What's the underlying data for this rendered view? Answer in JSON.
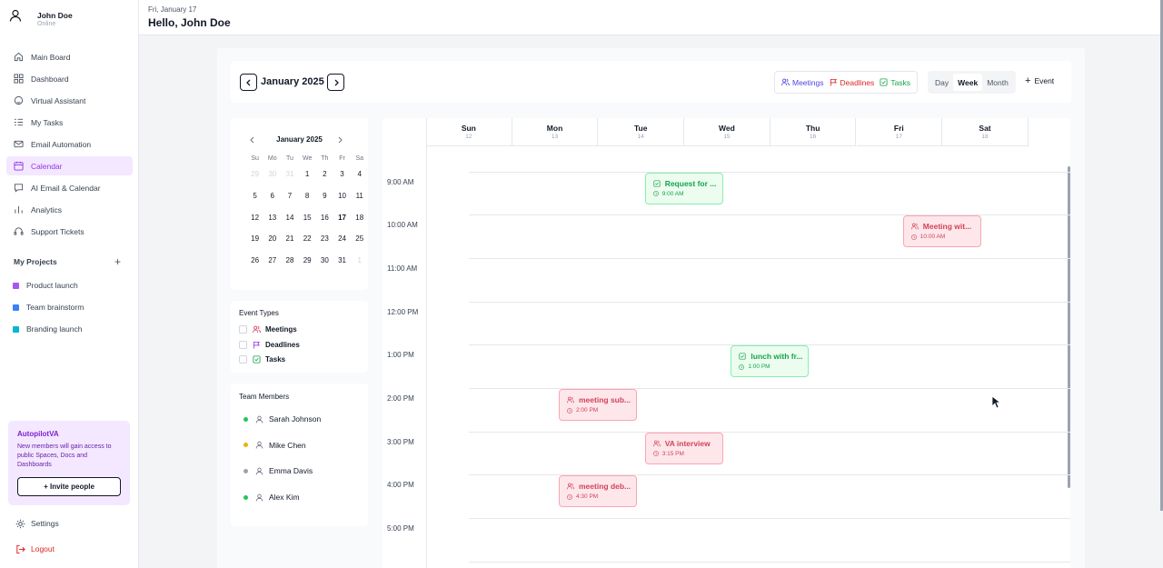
{
  "user": {
    "name": "John Doe",
    "status": "Online"
  },
  "sidebar": {
    "items": [
      {
        "label": "Main Board",
        "icon": "home-icon"
      },
      {
        "label": "Dashboard",
        "icon": "grid-icon"
      },
      {
        "label": "Virtual Assistant",
        "icon": "assistant-icon"
      },
      {
        "label": "My Tasks",
        "icon": "list-icon"
      },
      {
        "label": "Email Automation",
        "icon": "mail-icon"
      },
      {
        "label": "Calendar",
        "icon": "calendar-icon",
        "active": true
      },
      {
        "label": "AI Email & Calendar",
        "icon": "chat-icon"
      },
      {
        "label": "Analytics",
        "icon": "chart-icon"
      },
      {
        "label": "Support Tickets",
        "icon": "headset-icon"
      }
    ],
    "projects_title": "My Projects",
    "projects": [
      {
        "label": "Product launch",
        "color": "#a855f7"
      },
      {
        "label": "Team brainstorm",
        "color": "#3b82f6"
      },
      {
        "label": "Branding launch",
        "color": "#06b6d4"
      }
    ],
    "promo": {
      "title": "AutopilotVA",
      "desc": "New members will gain access to public Spaces, Docs and Dashboards",
      "button": "+ Invite people"
    },
    "settings": "Settings",
    "logout": "Logout"
  },
  "header": {
    "date": "Fri, January 17",
    "greeting": "Hello, John Doe"
  },
  "toolbar": {
    "month": "January 2025",
    "filters": {
      "meetings": "Meetings",
      "deadlines": "Deadlines",
      "tasks": "Tasks"
    },
    "views": {
      "day": "Day",
      "week": "Week",
      "month": "Month"
    },
    "add_event": "Event"
  },
  "mini": {
    "title": "January 2025",
    "dow": [
      "Su",
      "Mo",
      "Tu",
      "We",
      "Th",
      "Fr",
      "Sa"
    ],
    "days": [
      [
        "29",
        "30",
        "31",
        "1",
        "2",
        "3",
        "4"
      ],
      [
        "5",
        "6",
        "7",
        "8",
        "9",
        "10",
        "11"
      ],
      [
        "12",
        "13",
        "14",
        "15",
        "16",
        "17",
        "18"
      ],
      [
        "19",
        "20",
        "21",
        "22",
        "23",
        "24",
        "25"
      ],
      [
        "26",
        "27",
        "28",
        "29",
        "30",
        "31",
        "1"
      ]
    ],
    "muted": [
      [
        0,
        0
      ],
      [
        0,
        1
      ],
      [
        0,
        2
      ],
      [
        4,
        6
      ]
    ],
    "today": [
      2,
      5
    ]
  },
  "event_types": {
    "title": "Event Types",
    "items": [
      {
        "label": "Meetings",
        "icon": "people-icon",
        "color": "#d1435b"
      },
      {
        "label": "Deadlines",
        "icon": "flag-icon",
        "color": "#9333ea"
      },
      {
        "label": "Tasks",
        "icon": "check-square-icon",
        "color": "#16a34a"
      }
    ]
  },
  "team": {
    "title": "Team Members",
    "members": [
      {
        "name": "Sarah Johnson",
        "status_color": "#22c55e"
      },
      {
        "name": "Mike Chen",
        "status_color": "#eab308"
      },
      {
        "name": "Emma Davis",
        "status_color": "#9ca3af"
      },
      {
        "name": "Alex Kim",
        "status_color": "#22c55e"
      }
    ]
  },
  "week": {
    "days": [
      {
        "name": "Sun",
        "date": "12"
      },
      {
        "name": "Mon",
        "date": "13"
      },
      {
        "name": "Tue",
        "date": "14"
      },
      {
        "name": "Wed",
        "date": "15"
      },
      {
        "name": "Thu",
        "date": "16"
      },
      {
        "name": "Fri",
        "date": "17"
      },
      {
        "name": "Sat",
        "date": "18"
      }
    ],
    "hours": [
      "9:00 AM",
      "10:00 AM",
      "11:00 AM",
      "12:00 PM",
      "1:00 PM",
      "2:00 PM",
      "3:00 PM",
      "4:00 PM",
      "5:00 PM"
    ],
    "events": [
      {
        "title": "Request for ...",
        "time": "9:00 AM",
        "type": "task",
        "day": 2,
        "hour": 0
      },
      {
        "title": "Meeting wit...",
        "time": "10:00 AM",
        "type": "meeting",
        "day": 5,
        "hour": 1
      },
      {
        "title": "lunch with fr...",
        "time": "1:00 PM",
        "type": "task",
        "day": 3,
        "hour": 4
      },
      {
        "title": "meeting sub...",
        "time": "2:00 PM",
        "type": "meeting",
        "day": 1,
        "hour": 5
      },
      {
        "title": "VA interview",
        "time": "3:15 PM",
        "type": "meeting",
        "day": 2,
        "hour": 6
      },
      {
        "title": "meeting deb...",
        "time": "4:30 PM",
        "type": "meeting",
        "day": 1,
        "hour": 7
      }
    ]
  }
}
